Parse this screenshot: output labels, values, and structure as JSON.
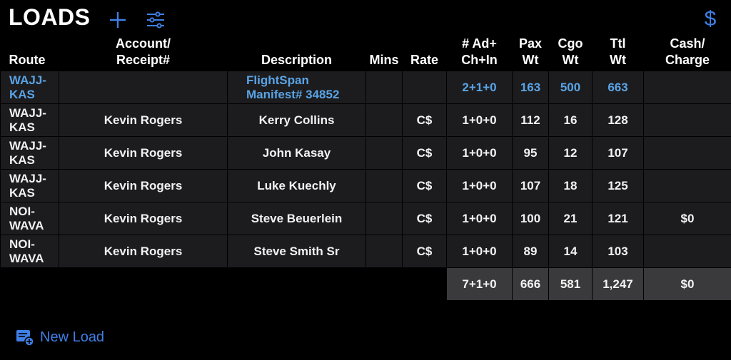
{
  "header": {
    "title": "LOADS",
    "add_icon": "plus-icon",
    "filter_icon": "sliders-icon",
    "dollar_icon": "$",
    "accent_color": "#3f7fe6"
  },
  "columns": {
    "route": "Route",
    "account_line1": "Account/",
    "account_line2": "Receipt#",
    "description": "Description",
    "mins": "Mins",
    "rate": "Rate",
    "ad_line1": "# Ad+",
    "ad_line2": "Ch+In",
    "pax_line1": "Pax",
    "pax_line2": "Wt",
    "cgo_line1": "Cgo",
    "cgo_line2": "Wt",
    "ttl_line1": "Ttl",
    "ttl_line2": "Wt",
    "cash_line1": "Cash/",
    "cash_line2": "Charge"
  },
  "rows": [
    {
      "route": "WAJJ-\nKAS",
      "account": "",
      "description": "FlightSpan\nManifest# 34852",
      "mins": "",
      "rate": "",
      "count": "2+1+0",
      "pax": "163",
      "cgo": "500",
      "ttl": "663",
      "cash": ""
    },
    {
      "route": "WAJJ-\nKAS",
      "account": "Kevin Rogers",
      "description": "Kerry Collins",
      "mins": "",
      "rate": "C$",
      "count": "1+0+0",
      "pax": "112",
      "cgo": "16",
      "ttl": "128",
      "cash": ""
    },
    {
      "route": "WAJJ-\nKAS",
      "account": "Kevin Rogers",
      "description": "John Kasay",
      "mins": "",
      "rate": "C$",
      "count": "1+0+0",
      "pax": "95",
      "cgo": "12",
      "ttl": "107",
      "cash": ""
    },
    {
      "route": "WAJJ-\nKAS",
      "account": "Kevin Rogers",
      "description": "Luke Kuechly",
      "mins": "",
      "rate": "C$",
      "count": "1+0+0",
      "pax": "107",
      "cgo": "18",
      "ttl": "125",
      "cash": ""
    },
    {
      "route": "NOI-\nWAVA",
      "account": "Kevin Rogers",
      "description": "Steve Beuerlein",
      "mins": "",
      "rate": "C$",
      "count": "1+0+0",
      "pax": "100",
      "cgo": "21",
      "ttl": "121",
      "cash": "$0"
    },
    {
      "route": "NOI-\nWAVA",
      "account": "Kevin Rogers",
      "description": "Steve Smith Sr",
      "mins": "",
      "rate": "C$",
      "count": "1+0+0",
      "pax": "89",
      "cgo": "14",
      "ttl": "103",
      "cash": ""
    }
  ],
  "totals": {
    "count": "7+1+0",
    "pax": "666",
    "cgo": "581",
    "ttl": "1,247",
    "cash": "$0"
  },
  "footer": {
    "new_load_label": "New Load",
    "new_load_icon": "new-document-icon"
  }
}
